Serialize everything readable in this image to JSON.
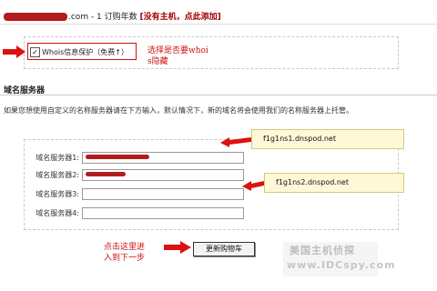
{
  "header": {
    "domain_suffix": ".com - 1 订购年数",
    "add_link": "[没有主机，点此添加]"
  },
  "whois": {
    "checkbox_mark": "✓",
    "label": "Whois信息保护（免费↑）",
    "annotation_line1": "选择是否要whoi",
    "annotation_line2": "s隐藏"
  },
  "nameservers": {
    "title": "域名服务器",
    "description": "如果您想使用自定义的名称服务器请在下方输入，默认情况下，新的域名将会使用我们的名称服务器上托管。",
    "fields": [
      {
        "label": "域名服务器1:",
        "value": ""
      },
      {
        "label": "域名服务器2:",
        "value": ""
      },
      {
        "label": "域名服务器3:",
        "value": ""
      },
      {
        "label": "域名服务器4:",
        "value": ""
      }
    ],
    "callout1": "f1g1ns1.dnspod.net",
    "callout2": "f1g1ns2.dnspod.net"
  },
  "footer": {
    "annotation_line1": "点击这里进",
    "annotation_line2": "入到下一步",
    "update_button": "更新购物车"
  },
  "watermark": {
    "line1": "美国主机侦探",
    "line2": "www.IDCspy.com"
  },
  "colors": {
    "annotation_red": "#cc1111",
    "callout_bg": "#fff8d6"
  }
}
